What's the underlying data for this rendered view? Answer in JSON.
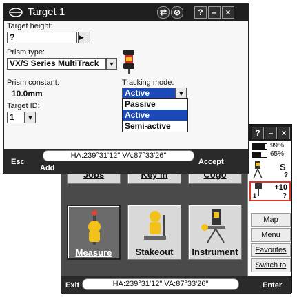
{
  "foreground": {
    "title": "Target 1",
    "target_height_label": "Target height:",
    "target_height_value": "?",
    "prism_type_label": "Prism type:",
    "prism_type_value": "VX/S Series MultiTrack",
    "prism_constant_label": "Prism constant:",
    "prism_constant_value": "10.0mm",
    "tracking_mode_label": "Tracking mode:",
    "tracking_mode_value": "Active",
    "tracking_mode_options": [
      "Passive",
      "Active",
      "Semi-active"
    ],
    "target_id_label": "Target ID:",
    "target_id_value": "1",
    "hava": "HA:239°31'12\"  VA:87°33'26\"",
    "footer": {
      "esc": "Esc",
      "add": "Add",
      "accept": "Accept"
    },
    "titlebar_buttons": [
      "?",
      "–",
      "×"
    ]
  },
  "background": {
    "tiles": [
      "Jobs",
      "Key in",
      "Cogo",
      "Measure",
      "Stakeout",
      "Instrument"
    ],
    "battery1": "99%",
    "battery2": "65%",
    "status_s": "S",
    "status_q1": "?",
    "target_offset": "+10",
    "target_id": "1",
    "status_q2": "?",
    "side_buttons": [
      "Map",
      "Menu",
      "Favorites",
      "Switch to"
    ],
    "hava": "HA:239°31'12\"  VA:87°33'26\"",
    "footer": {
      "exit": "Exit",
      "enter": "Enter"
    },
    "titlebar_buttons": [
      "?",
      "–",
      "×"
    ]
  },
  "colors": {
    "selection_blue": "#1c49b8",
    "highlight_red": "#e0332a",
    "prism_yellow": "#f2c21a"
  }
}
